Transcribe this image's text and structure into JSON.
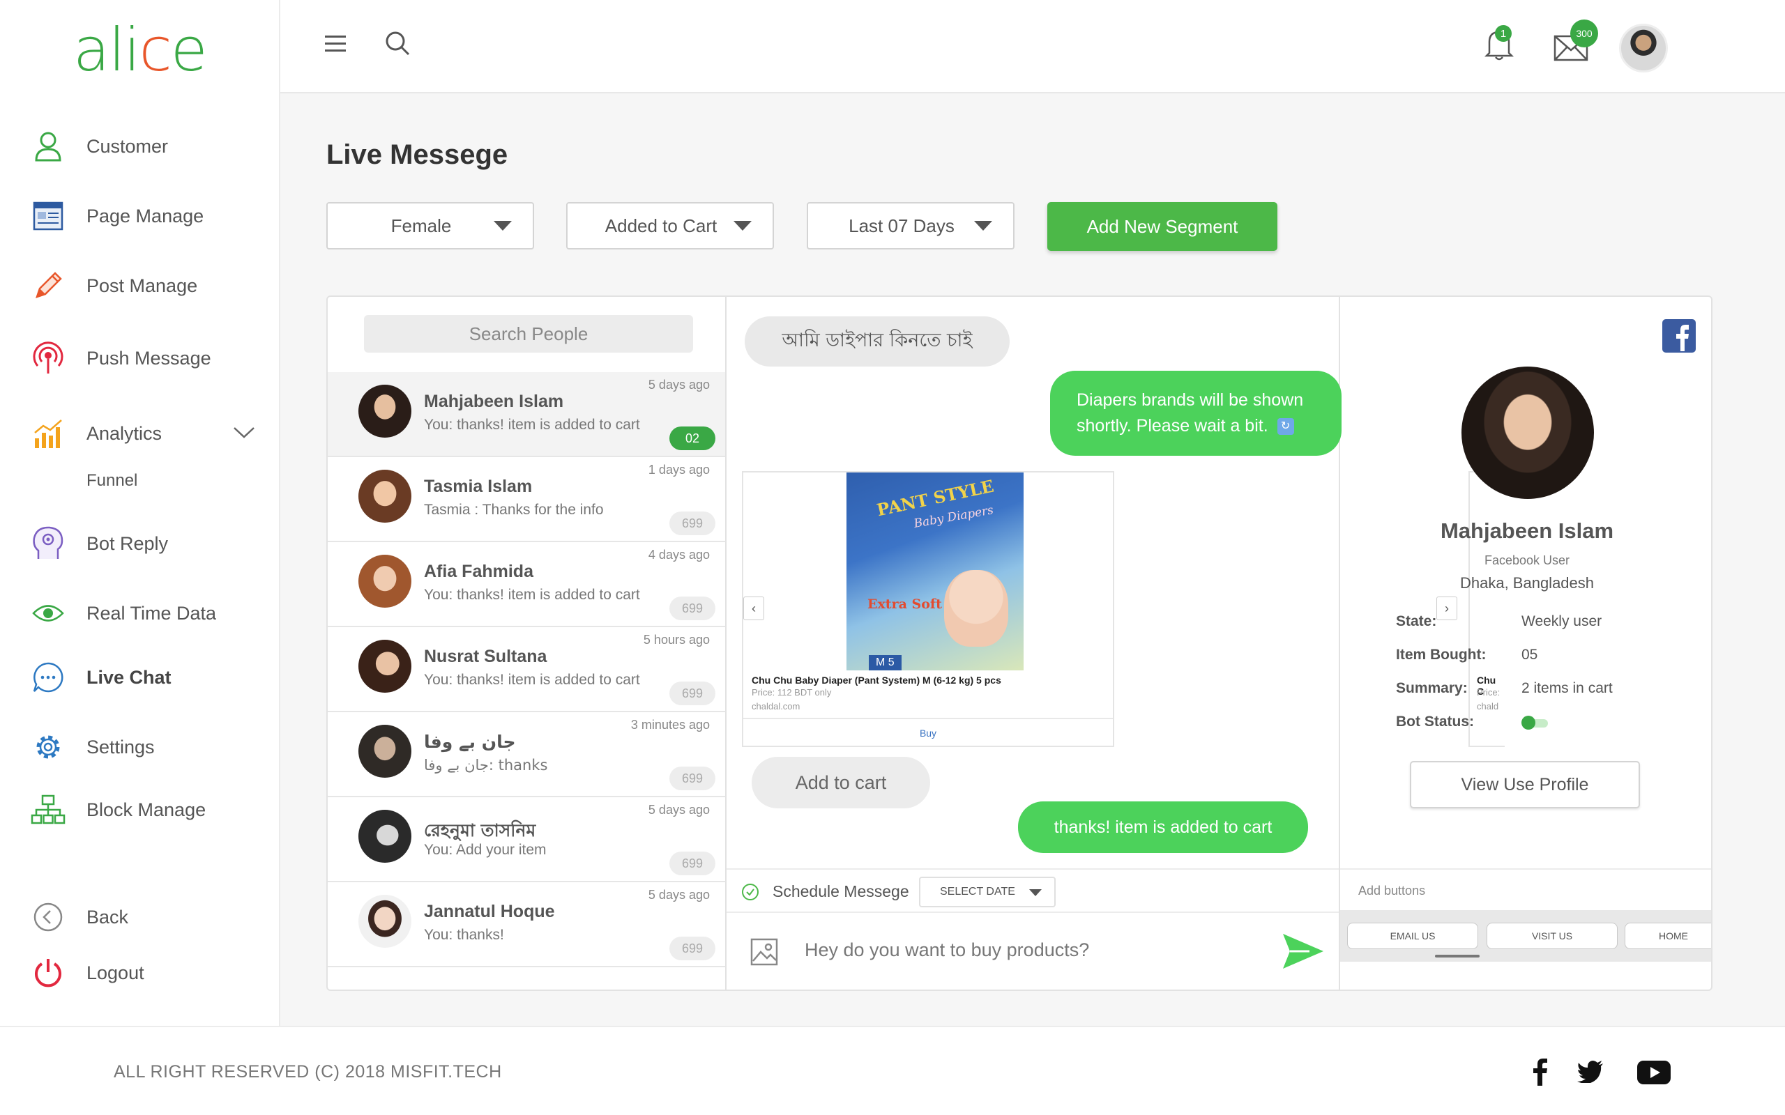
{
  "app": {
    "logo_text_a": "ali",
    "logo_text_b": "c",
    "logo_text_c": "e"
  },
  "sidebar": {
    "items": [
      {
        "label": "Customer",
        "icon": "user-icon"
      },
      {
        "label": "Page Manage",
        "icon": "page-icon"
      },
      {
        "label": "Post Manage",
        "icon": "pencil-icon"
      },
      {
        "label": "Push Message",
        "icon": "broadcast-icon"
      },
      {
        "label": "Analytics",
        "icon": "analytics-icon"
      },
      {
        "label": "Bot Reply",
        "icon": "brain-icon"
      },
      {
        "label": "Real Time Data",
        "icon": "eye-icon"
      },
      {
        "label": "Live Chat",
        "icon": "chat-icon"
      },
      {
        "label": "Settings",
        "icon": "gear-icon"
      },
      {
        "label": "Block Manage",
        "icon": "hierarchy-icon"
      },
      {
        "label": "Back",
        "icon": "back-icon"
      },
      {
        "label": "Logout",
        "icon": "power-icon"
      }
    ],
    "sub_item": "Funnel"
  },
  "header": {
    "notification_count": "1",
    "message_count": "300"
  },
  "main": {
    "title": "Live Messege",
    "filters": [
      "Female",
      "Added to Cart",
      "Last 07 Days"
    ],
    "add_segment_label": "Add New Segment"
  },
  "contacts": {
    "search_placeholder": "Search People",
    "items": [
      {
        "name": "Mahjabeen Islam",
        "message": "You: thanks! item is added to cart",
        "time": "5 days ago",
        "count": "02"
      },
      {
        "name": "Tasmia Islam",
        "message": "Tasmia : Thanks for the info",
        "time": "1 days ago",
        "count": "699"
      },
      {
        "name": "Afia Fahmida",
        "message": "You: thanks! item is added to cart",
        "time": "4 days ago",
        "count": "699"
      },
      {
        "name": "Nusrat Sultana",
        "message": "You: thanks! item is added to cart",
        "time": "5 hours ago",
        "count": "699"
      },
      {
        "name": "جان بے وفا",
        "message": "جان بے وفا: thanks",
        "time": "3 minutes ago",
        "count": "699"
      },
      {
        "name": "রেহনুমা তাসনিম",
        "message": "You: Add your item",
        "time": "5 days ago",
        "count": "699"
      },
      {
        "name": "Jannatul Hoque",
        "message": "You: thanks!",
        "time": "5 days ago",
        "count": "699"
      }
    ]
  },
  "chat": {
    "incoming_1": "আমি ডাইপার কিনতে চাই",
    "outgoing_1_line1": "Diapers brands will be shown",
    "outgoing_1_line2": "shortly. Please wait a bit.",
    "product": {
      "brand": "PANT STYLE",
      "brand_sub": "Baby Diapers",
      "label": "Extra Soft",
      "size": "M 5",
      "title": "Chu Chu Baby Diaper (Pant System) M (6-12 kg) 5 pcs",
      "price": "Price: 112 BDT only",
      "url": "chaldal.com",
      "buy": "Buy",
      "next_title": "Chu C",
      "next_price": "Price:",
      "next_url": "chald"
    },
    "incoming_2": "Add to cart",
    "outgoing_2": "thanks! item is added to cart",
    "schedule_label": "Schedule Messege",
    "select_date": "SELECT DATE",
    "compose_placeholder": "Hey do you want to buy products?"
  },
  "profile": {
    "name": "Mahjabeen Islam",
    "role": "Facebook User",
    "location": "Dhaka, Bangladesh",
    "fields": [
      {
        "key": "State:",
        "value": "Weekly user"
      },
      {
        "key": "Item Bought:",
        "value": "05"
      },
      {
        "key": "Summary:",
        "value": "2 items in cart"
      },
      {
        "key": "Bot Status:",
        "value": ""
      }
    ],
    "bot_status_on": true,
    "view_profile_label": "View Use Profile",
    "add_buttons_label": "Add buttons",
    "buttons": [
      "EMAIL US",
      "VISIT US",
      "HOME"
    ]
  },
  "footer": {
    "copyright": "ALL RIGHT RESERVED (C) 2018  MISFIT.TECH"
  },
  "colors": {
    "accent": "#4cb848",
    "bubble_out": "#4cd25b",
    "logout": "#e2283f"
  }
}
